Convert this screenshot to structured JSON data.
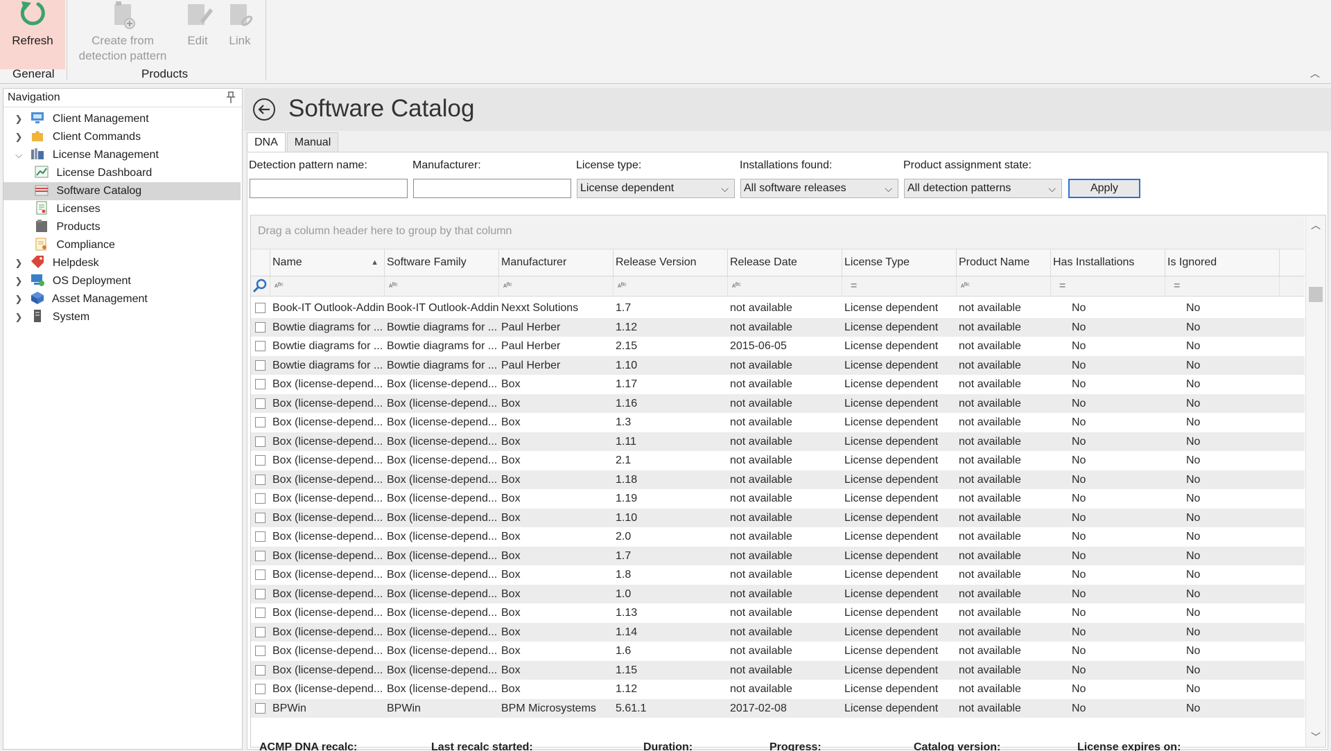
{
  "ribbon": {
    "refresh_label": "Refresh",
    "create_label_1": "Create from",
    "create_label_2": "detection pattern",
    "edit_label": "Edit",
    "link_label": "Link",
    "group_general": "General",
    "group_products": "Products"
  },
  "nav": {
    "title": "Navigation",
    "items": [
      {
        "label": "Client Management",
        "icon": "client-management-icon"
      },
      {
        "label": "Client Commands",
        "icon": "puzzle-icon"
      },
      {
        "label": "License Management",
        "icon": "license-management-icon"
      },
      {
        "label": "License Dashboard",
        "icon": "dashboard-chart-icon"
      },
      {
        "label": "Software Catalog",
        "icon": "software-catalog-icon"
      },
      {
        "label": "Licenses",
        "icon": "license-document-icon"
      },
      {
        "label": "Products",
        "icon": "products-icon"
      },
      {
        "label": "Compliance",
        "icon": "compliance-icon"
      },
      {
        "label": "Helpdesk",
        "icon": "helpdesk-tag-icon"
      },
      {
        "label": "OS Deployment",
        "icon": "os-deployment-icon"
      },
      {
        "label": "Asset Management",
        "icon": "asset-cube-icon"
      },
      {
        "label": "System",
        "icon": "system-tower-icon"
      }
    ]
  },
  "main": {
    "title": "Software Catalog",
    "tabs": [
      "DNA",
      "Manual"
    ],
    "filters": {
      "detection_label": "Detection pattern name:",
      "detection_value": "",
      "manufacturer_label": "Manufacturer:",
      "manufacturer_value": "",
      "license_type_label": "License type:",
      "license_type_value": "License dependent",
      "installations_label": "Installations found:",
      "installations_value": "All software releases",
      "assignment_label": "Product assignment state:",
      "assignment_value": "All detection patterns",
      "apply_label": "Apply"
    },
    "group_hint": "Drag a column header here to group by that column",
    "columns": [
      "Name",
      "Software Family",
      "Manufacturer",
      "Release Version",
      "Release Date",
      "License Type",
      "Product Name",
      "Has Installations",
      "Is Ignored"
    ],
    "rows": [
      [
        "Book-IT Outlook-Addin",
        "Book-IT Outlook-Addin",
        "Nexxt Solutions",
        "1.7",
        "not available",
        "License dependent",
        "not available",
        "No",
        "No"
      ],
      [
        "Bowtie diagrams for ...",
        "Bowtie diagrams for ...",
        "Paul Herber",
        "1.12",
        "not available",
        "License dependent",
        "not available",
        "No",
        "No"
      ],
      [
        "Bowtie diagrams for ...",
        "Bowtie diagrams for ...",
        "Paul Herber",
        "2.15",
        "2015-06-05",
        "License dependent",
        "not available",
        "No",
        "No"
      ],
      [
        "Bowtie diagrams for ...",
        "Bowtie diagrams for ...",
        "Paul Herber",
        "1.10",
        "not available",
        "License dependent",
        "not available",
        "No",
        "No"
      ],
      [
        "Box (license-depend...",
        "Box (license-depend...",
        "Box",
        "1.17",
        "not available",
        "License dependent",
        "not available",
        "No",
        "No"
      ],
      [
        "Box (license-depend...",
        "Box (license-depend...",
        "Box",
        "1.16",
        "not available",
        "License dependent",
        "not available",
        "No",
        "No"
      ],
      [
        "Box (license-depend...",
        "Box (license-depend...",
        "Box",
        "1.3",
        "not available",
        "License dependent",
        "not available",
        "No",
        "No"
      ],
      [
        "Box (license-depend...",
        "Box (license-depend...",
        "Box",
        "1.11",
        "not available",
        "License dependent",
        "not available",
        "No",
        "No"
      ],
      [
        "Box (license-depend...",
        "Box (license-depend...",
        "Box",
        "2.1",
        "not available",
        "License dependent",
        "not available",
        "No",
        "No"
      ],
      [
        "Box (license-depend...",
        "Box (license-depend...",
        "Box",
        "1.18",
        "not available",
        "License dependent",
        "not available",
        "No",
        "No"
      ],
      [
        "Box (license-depend...",
        "Box (license-depend...",
        "Box",
        "1.19",
        "not available",
        "License dependent",
        "not available",
        "No",
        "No"
      ],
      [
        "Box (license-depend...",
        "Box (license-depend...",
        "Box",
        "1.10",
        "not available",
        "License dependent",
        "not available",
        "No",
        "No"
      ],
      [
        "Box (license-depend...",
        "Box (license-depend...",
        "Box",
        "2.0",
        "not available",
        "License dependent",
        "not available",
        "No",
        "No"
      ],
      [
        "Box (license-depend...",
        "Box (license-depend...",
        "Box",
        "1.7",
        "not available",
        "License dependent",
        "not available",
        "No",
        "No"
      ],
      [
        "Box (license-depend...",
        "Box (license-depend...",
        "Box",
        "1.8",
        "not available",
        "License dependent",
        "not available",
        "No",
        "No"
      ],
      [
        "Box (license-depend...",
        "Box (license-depend...",
        "Box",
        "1.0",
        "not available",
        "License dependent",
        "not available",
        "No",
        "No"
      ],
      [
        "Box (license-depend...",
        "Box (license-depend...",
        "Box",
        "1.13",
        "not available",
        "License dependent",
        "not available",
        "No",
        "No"
      ],
      [
        "Box (license-depend...",
        "Box (license-depend...",
        "Box",
        "1.14",
        "not available",
        "License dependent",
        "not available",
        "No",
        "No"
      ],
      [
        "Box (license-depend...",
        "Box (license-depend...",
        "Box",
        "1.6",
        "not available",
        "License dependent",
        "not available",
        "No",
        "No"
      ],
      [
        "Box (license-depend...",
        "Box (license-depend...",
        "Box",
        "1.15",
        "not available",
        "License dependent",
        "not available",
        "No",
        "No"
      ],
      [
        "Box (license-depend...",
        "Box (license-depend...",
        "Box",
        "1.12",
        "not available",
        "License dependent",
        "not available",
        "No",
        "No"
      ],
      [
        "BPWin",
        "BPWin",
        "BPM Microsystems",
        "5.61.1",
        "2017-02-08",
        "License dependent",
        "not available",
        "No",
        "No"
      ]
    ],
    "status_labels": [
      "ACMP DNA recalc:",
      "Last recalc started:",
      "Duration:",
      "Progress:",
      "Catalog version:",
      "License expires on:"
    ]
  },
  "colors": {
    "refresh_highlight": "#f9d6cf",
    "refresh_icon": "#3aa36b",
    "apply_border": "#2f6fd6",
    "selected_nav": "#d6d6d6"
  }
}
